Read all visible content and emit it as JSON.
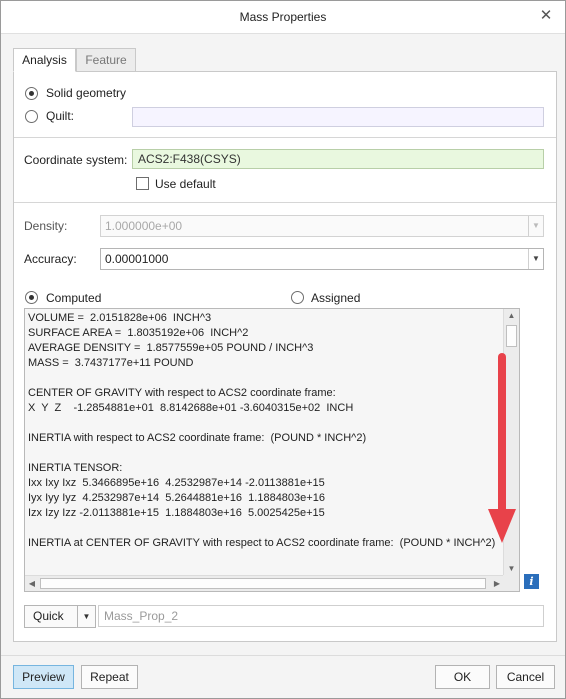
{
  "window": {
    "title": "Mass Properties"
  },
  "tabs": {
    "analysis": "Analysis",
    "feature": "Feature"
  },
  "geometry": {
    "solid_label": "Solid geometry",
    "quilt_label": "Quilt:",
    "quilt_value": "",
    "selected": "solid"
  },
  "coordinate_system": {
    "label": "Coordinate system:",
    "value": "ACS2:F438(CSYS)",
    "use_default_label": "Use default",
    "use_default_checked": false
  },
  "density": {
    "label": "Density:",
    "value": "1.000000e+00",
    "enabled": false
  },
  "accuracy": {
    "label": "Accuracy:",
    "value": "0.00001000"
  },
  "mode": {
    "computed_label": "Computed",
    "assigned_label": "Assigned",
    "selected": "computed"
  },
  "results": {
    "lines": [
      "VOLUME =  2.0151828e+06  INCH^3",
      "SURFACE AREA =  1.8035192e+06  INCH^2",
      "AVERAGE DENSITY =  1.8577559e+05 POUND / INCH^3",
      "MASS =  3.7437177e+11 POUND",
      "",
      "CENTER OF GRAVITY with respect to ACS2 coordinate frame:",
      "X  Y  Z    -1.2854881e+01  8.8142688e+01 -3.6040315e+02  INCH",
      "",
      "INERTIA with respect to ACS2 coordinate frame:  (POUND * INCH^2)",
      "",
      "INERTIA TENSOR:",
      "Ixx Ixy Ixz  5.3466895e+16  4.2532987e+14 -2.0113881e+15",
      "Iyx Iyy Iyz  4.2532987e+14  5.2644881e+16  1.1884803e+16",
      "Izx Izy Izz -2.0113881e+15  1.1884803e+16  5.0025425e+15",
      "",
      "INERTIA at CENTER OF GRAVITY with respect to ACS2 coordinate frame:  (POUND * INCH^2)"
    ]
  },
  "bottom": {
    "quick_label": "Quick",
    "feature_name": "Mass_Prop_2"
  },
  "buttons": {
    "preview": "Preview",
    "repeat": "Repeat",
    "ok": "OK",
    "cancel": "Cancel"
  },
  "icons": {
    "close": "close-icon",
    "info": "info-icon",
    "dropdown": "chevron-down-icon"
  },
  "colors": {
    "arrow": "#e8424a",
    "csys_field": "#e9f8df",
    "preview_button": "#cfe7f7",
    "info": "#2a6ebb"
  }
}
